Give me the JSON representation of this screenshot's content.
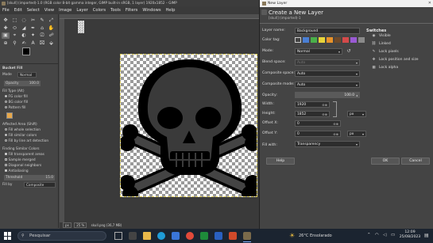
{
  "window": {
    "title": "[skull] (imported)-1.0 (RGB color 8-bit gamma integer, GIMP built-in sRGB, 1 layer) 1920x1852 – GIMP"
  },
  "menu": [
    "File",
    "Edit",
    "Select",
    "View",
    "Image",
    "Layer",
    "Colors",
    "Tools",
    "Filters",
    "Windows",
    "Help"
  ],
  "tools": [
    "✥",
    "⬚",
    "◌",
    "✂",
    "✎",
    "⤢",
    "✚",
    "⬭",
    "◢",
    "✒",
    "⌂",
    "✋",
    "▣",
    "⌖",
    "◐",
    "✦",
    "⎚",
    "☍",
    "⊕",
    "⚲",
    "✍",
    "A",
    "⌧",
    "⬙"
  ],
  "tool_options": {
    "title": "Bucket Fill",
    "mode_label": "Mode",
    "mode_value": "Normal",
    "opacity_label": "Opacity",
    "opacity_value": "100.0",
    "fill_type_label": "Fill Type (Alt)",
    "fill_types": [
      "FG color fill",
      "BG color fill",
      "Pattern fill"
    ],
    "affected_label": "Affected Area (Shift)",
    "affected": [
      "Fill whole selection",
      "Fill similar colors",
      "Fill by line art detection"
    ],
    "finding_label": "Finding Similar Colors",
    "finding": [
      "Fill transparent areas",
      "Sample merged",
      "Diagonal neighbors",
      "Antialiasing"
    ],
    "threshold_label": "Threshold",
    "threshold_value": "15.0",
    "fillby_label": "Fill by",
    "fillby_value": "Composite"
  },
  "statusbar": {
    "units": "px",
    "zoom": "25 %",
    "info": "skull.png (36,7 MB)"
  },
  "dialog": {
    "window_title": "New Layer",
    "heading": "Create a New Layer",
    "subheading": "[skull] (imported)-1",
    "layer_name_label": "Layer name:",
    "layer_name_value": "Background",
    "color_tag_label": "Color tag:",
    "mode_label": "Mode:",
    "mode_value": "Normal",
    "blend_label": "Blend space:",
    "blend_value": "Auto",
    "composite_space_label": "Composite space:",
    "composite_space_value": "Auto",
    "composite_mode_label": "Composite mode:",
    "composite_mode_value": "Auto",
    "opacity_label": "Opacity:",
    "opacity_value": "100.0",
    "width_label": "Width:",
    "width_value": "1920",
    "height_label": "Height:",
    "height_value": "1852",
    "unit_value": "px",
    "offx_label": "Offset X:",
    "offx_value": "0",
    "offy_label": "Offset Y:",
    "offy_value": "0",
    "fill_label": "Fill with:",
    "fill_value": "Transparency",
    "switches_label": "Switches",
    "switches": [
      "Visible",
      "Linked",
      "Lock pixels",
      "Lock position and size",
      "Lock alpha"
    ],
    "help_button": "Help",
    "ok_button": "OK",
    "cancel_button": "Cancel",
    "color_tags": [
      "#7f7f7f",
      "#4a7fd4",
      "#4ab04a",
      "#e8d43a",
      "#e8922a",
      "#6e4a2a",
      "#d44a4a",
      "#9a5ad4",
      "#8a8a8a"
    ]
  },
  "taskbar": {
    "search_placeholder": "Pesquisar",
    "weather": "26°C  Ensolarado",
    "time": "12:09",
    "date": "25/08/2023"
  }
}
